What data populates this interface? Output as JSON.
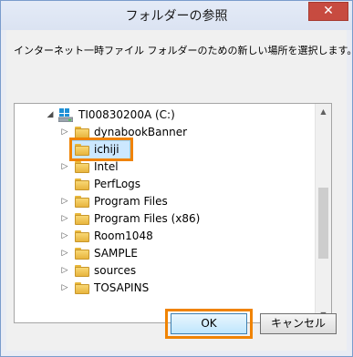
{
  "window": {
    "title": "フォルダーの参照",
    "close_glyph": "✕"
  },
  "description": "インターネット一時ファイル フォルダーのための新しい場所を選択します。",
  "tree": {
    "root": {
      "label": "TI00830200A (C:)",
      "expanded": true
    },
    "items": [
      {
        "label": "dynabookBanner",
        "has_children": true,
        "selected": false
      },
      {
        "label": "ichiji",
        "has_children": false,
        "selected": true
      },
      {
        "label": "Intel",
        "has_children": true,
        "selected": false
      },
      {
        "label": "PerfLogs",
        "has_children": false,
        "selected": false
      },
      {
        "label": "Program Files",
        "has_children": true,
        "selected": false
      },
      {
        "label": "Program Files (x86)",
        "has_children": true,
        "selected": false
      },
      {
        "label": "Room1048",
        "has_children": true,
        "selected": false
      },
      {
        "label": "SAMPLE",
        "has_children": true,
        "selected": false
      },
      {
        "label": "sources",
        "has_children": true,
        "selected": false
      },
      {
        "label": "TOSAPINS",
        "has_children": true,
        "selected": false
      }
    ]
  },
  "buttons": {
    "ok": "OK",
    "cancel": "キャンセル"
  },
  "colors": {
    "highlight": "#f08300",
    "title_bg": "#dbe3f2",
    "close": "#c74b40"
  }
}
